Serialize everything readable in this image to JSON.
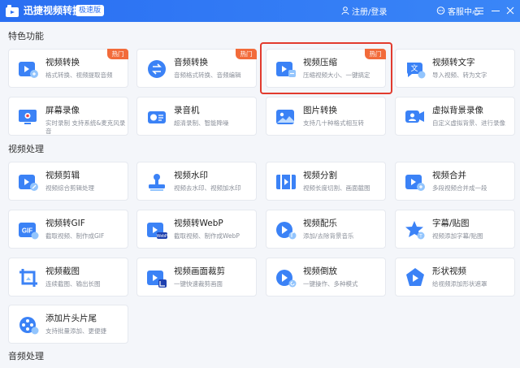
{
  "titlebar": {
    "app_title": "迅捷视频转换器",
    "edition": "极速版",
    "login": "注册/登录",
    "support": "客服中心"
  },
  "sections": {
    "special": "特色功能",
    "video": "视频处理",
    "audio": "音频处理"
  },
  "badge": "热门",
  "colors": {
    "primary": "#2a6ff2",
    "hot": "#f26b3a",
    "highlight": "#e23b2e"
  },
  "cards": [
    {
      "name": "视频转换",
      "desc": "格式转换、视频提取音频",
      "hot": true,
      "icon": "video-convert-icon"
    },
    {
      "name": "音频转换",
      "desc": "音频格式转换、音频编辑",
      "hot": true,
      "icon": "audio-convert-icon"
    },
    {
      "name": "视频压缩",
      "desc": "压缩视频大小、一键搞定",
      "hot": true,
      "icon": "video-compress-icon"
    },
    {
      "name": "视频转文字",
      "desc": "导入视频、转为文字",
      "hot": false,
      "icon": "video-to-text-icon"
    },
    {
      "name": "屏幕录像",
      "desc": "实时录制 支持系统&麦克风录音",
      "hot": false,
      "icon": "screen-record-icon"
    },
    {
      "name": "录音机",
      "desc": "超清录制、智能降噪",
      "hot": false,
      "icon": "recorder-icon"
    },
    {
      "name": "图片转换",
      "desc": "支持几十种格式相互转",
      "hot": false,
      "icon": "image-convert-icon"
    },
    {
      "name": "虚拟背景录像",
      "desc": "自定义虚拟背景、进行录像",
      "hot": false,
      "icon": "virtual-bg-icon"
    },
    {
      "name": "视频剪辑",
      "desc": "视频综合剪辑处理",
      "hot": false,
      "icon": "video-edit-icon"
    },
    {
      "name": "视频水印",
      "desc": "视频去水印、视频加水印",
      "hot": false,
      "icon": "watermark-icon"
    },
    {
      "name": "视频分割",
      "desc": "视频长度切割、画面截图",
      "hot": false,
      "icon": "video-split-icon"
    },
    {
      "name": "视频合并",
      "desc": "多段视频合并成一段",
      "hot": false,
      "icon": "video-merge-icon"
    },
    {
      "name": "视频转GIF",
      "desc": "截取视频、制作成GIF",
      "hot": false,
      "icon": "gif-icon"
    },
    {
      "name": "视频转WebP",
      "desc": "截取视频、制作成WebP",
      "hot": false,
      "icon": "webp-icon"
    },
    {
      "name": "视频配乐",
      "desc": "添加/去除背景音乐",
      "hot": false,
      "icon": "music-icon"
    },
    {
      "name": "字幕/贴图",
      "desc": "视频添加字幕/贴图",
      "hot": false,
      "icon": "subtitle-icon"
    },
    {
      "name": "视频截图",
      "desc": "连续截图、输出长图",
      "hot": false,
      "icon": "screenshot-icon"
    },
    {
      "name": "视频画面裁剪",
      "desc": "一键快速裁剪画面",
      "hot": false,
      "icon": "crop-icon"
    },
    {
      "name": "视频倒放",
      "desc": "一键操作、多种模式",
      "hot": false,
      "icon": "reverse-icon"
    },
    {
      "name": "形状视频",
      "desc": "给视频添加形状遮罩",
      "hot": false,
      "icon": "shape-icon"
    },
    {
      "name": "添加片头片尾",
      "desc": "支持批量添加、更便捷",
      "hot": false,
      "icon": "intro-outro-icon"
    }
  ]
}
